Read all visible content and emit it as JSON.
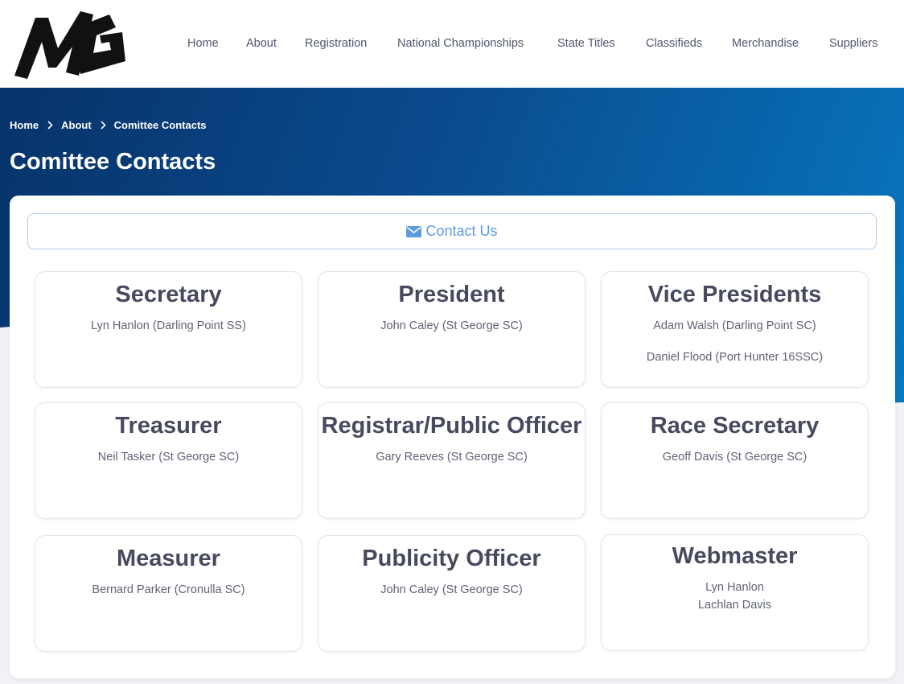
{
  "brand": {
    "logo_text": "MG"
  },
  "nav": {
    "items": [
      {
        "label": "Home"
      },
      {
        "label": "About"
      },
      {
        "label": "Registration"
      },
      {
        "label": "National Championships"
      },
      {
        "label": "State Titles"
      },
      {
        "label": "Classifieds"
      },
      {
        "label": "Merchandise"
      },
      {
        "label": "Suppliers"
      }
    ]
  },
  "breadcrumb": {
    "items": [
      {
        "label": "Home"
      },
      {
        "label": "About"
      },
      {
        "label": "Comittee Contacts"
      }
    ]
  },
  "page": {
    "title": "Comittee Contacts"
  },
  "contact_button": {
    "label": "Contact Us",
    "icon": "envelope-icon"
  },
  "cards": [
    {
      "title": "Secretary",
      "lines": [
        "Lyn Hanlon (Darling Point SS)"
      ]
    },
    {
      "title": "President",
      "lines": [
        "John Caley (St George SC)"
      ]
    },
    {
      "title": "Vice Presidents",
      "lines": [
        "Adam Walsh (Darling Point SC)",
        "Daniel Flood (Port Hunter 16SSC)"
      ]
    },
    {
      "title": "Treasurer",
      "lines": [
        "Neil Tasker (St George SC)"
      ]
    },
    {
      "title": "Registrar/Public Officer",
      "lines": [
        "Gary Reeves (St George SC)"
      ]
    },
    {
      "title": "Race Secretary",
      "lines": [
        "Geoff Davis  (St George SC)"
      ]
    },
    {
      "title": "Measurer",
      "lines": [
        "Bernard Parker (Cronulla SC)"
      ]
    },
    {
      "title": "Publicity Officer",
      "lines": [
        "John Caley (St George SC)"
      ]
    },
    {
      "title": "Webmaster",
      "lines": [
        "Lyn Hanlon",
        "Lachlan Davis"
      ]
    }
  ],
  "colors": {
    "hero_start": "#07336a",
    "hero_end": "#0778c0",
    "accent": "#5b9be0",
    "title_text": "#474a5e"
  }
}
